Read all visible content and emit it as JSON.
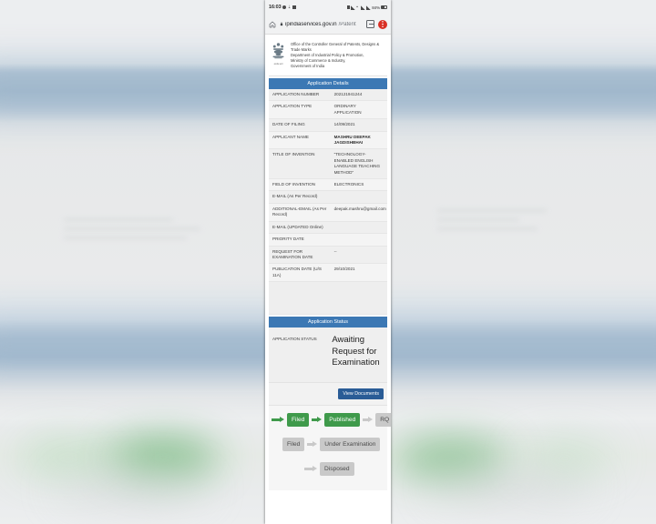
{
  "statusbar": {
    "time": "16:03",
    "left_icons": [
      "message-icon",
      "download-icon",
      "calendar-icon"
    ],
    "right_icons": [
      "screenshot-icon",
      "wifi-icon",
      "vpn-icon",
      "signal-icon",
      "signal-2-icon",
      "battery-icon"
    ],
    "battery_text": "84%"
  },
  "browser": {
    "home_icon": "home-icon",
    "lock_icon": "lock-icon",
    "url_domain": "ipindiaservices.gov.in",
    "url_path": "/Patent",
    "tabs_icon": "tabs-icon",
    "menu_icon": "menu-icon"
  },
  "gov_header": {
    "emblem_caption": "सत्यमेव जयते",
    "lines": [
      "Office of the Controller General of Patents, Designs & Trade Marks",
      "Department of Industrial Policy & Promotion,",
      "Ministry of Commerce & Industry,",
      "Government of India"
    ]
  },
  "details": {
    "heading": "Application Details",
    "rows": [
      {
        "label": "APPLICATION NUMBER",
        "value": "202121941244",
        "strong": false
      },
      {
        "label": "APPLICATION TYPE",
        "value": "ORDINARY APPLICATION",
        "strong": false
      },
      {
        "label": "DATE OF FILING",
        "value": "14/09/2021",
        "strong": false
      },
      {
        "label": "APPLICANT NAME",
        "value": "MASHRU DEEPAK JAGDISHBHAI",
        "strong": true
      },
      {
        "label": "TITLE OF INVENTION",
        "value": "\"TECHNOLOGY-ENABLED ENGLISH LANGUAGE TEACHING METHOD\"",
        "strong": false
      },
      {
        "label": "FIELD OF INVENTION",
        "value": "ELECTRONICS",
        "strong": false
      },
      {
        "label": "E-MAIL (As Per Record)",
        "value": "",
        "strong": false
      },
      {
        "label": "ADDITIONAL-EMAIL (As Per Record)",
        "value": "deepak.mashru@gmail.com",
        "strong": false
      },
      {
        "label": "E-MAIL (UPDATED Online)",
        "value": "",
        "strong": false
      },
      {
        "label": "PRIORITY DATE",
        "value": "",
        "strong": false
      },
      {
        "label": "REQUEST FOR EXAMINATION DATE",
        "value": "--",
        "strong": false
      },
      {
        "label": "PUBLICATION DATE (U/S 11A)",
        "value": "29/10/2021",
        "strong": false
      }
    ]
  },
  "status": {
    "heading": "Application Status",
    "label": "APPLICATION STATUS",
    "value": "Awaiting Request for Examination"
  },
  "documents": {
    "button_label": "View Documents"
  },
  "flow": {
    "row1": [
      {
        "type": "arrow",
        "state": "done"
      },
      {
        "type": "node",
        "label": "Filed",
        "state": "done"
      },
      {
        "type": "arrow",
        "state": "done"
      },
      {
        "type": "node",
        "label": "Published",
        "state": "done"
      },
      {
        "type": "arrow",
        "state": "pending"
      },
      {
        "type": "node",
        "label": "RQ",
        "state": "pending"
      }
    ],
    "row2": [
      {
        "type": "node",
        "label": "Filed",
        "state": "pending"
      },
      {
        "type": "arrow",
        "state": "pending"
      },
      {
        "type": "node",
        "label": "Under Examination",
        "state": "pending"
      }
    ],
    "row3": [
      {
        "type": "arrow",
        "state": "pending"
      },
      {
        "type": "node",
        "label": "Disposed",
        "state": "pending"
      }
    ]
  },
  "colors": {
    "section_header": "#3c78b4",
    "button": "#2a5c96",
    "flow_done": "#3f9a4b",
    "flow_pending": "#c9c9c9"
  }
}
